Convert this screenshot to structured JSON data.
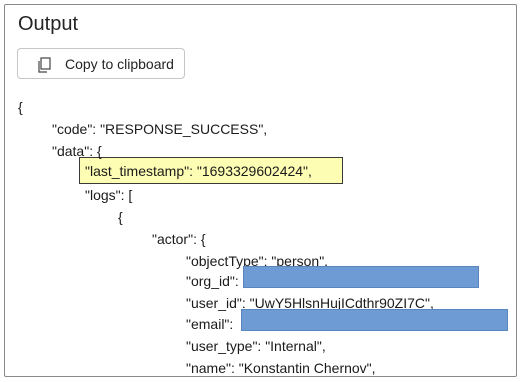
{
  "panel": {
    "title": "Output",
    "copy_button_label": "Copy to clipboard",
    "copy_icon": "copy-icon"
  },
  "json_lines": {
    "l0": "{",
    "l1": "\"code\": \"RESPONSE_SUCCESS\",",
    "l2": "\"data\": {",
    "l3": "\"last_timestamp\": \"1693329602424\",",
    "l4": "\"logs\": [",
    "l5": "{",
    "l6": "\"actor\": {",
    "l7": "\"objectType\": \"person\",",
    "l8": "\"org_id\":",
    "l9": "\"user_id\": \"UwY5HlsnHujICdthr90ZI7C\",",
    "l10": "\"email\":",
    "l11": "\"user_type\": \"Internal\",",
    "l12": "\"name\": \"Konstantin Chernov\","
  },
  "colors": {
    "highlight_fill": "#fdfdb3",
    "redaction_fill": "#6e9bd3"
  }
}
